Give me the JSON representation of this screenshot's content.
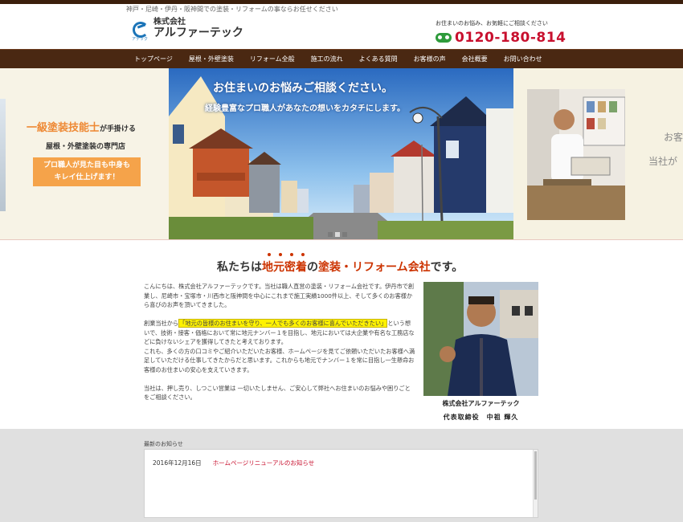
{
  "header": {
    "tagline": "神戸・尼崎・伊丹・阪神間での塗装・リフォームの事ならお任せください",
    "logo_line1": "株式会社",
    "logo_line2": "アルファーテック",
    "logo_sub": "アテック",
    "contact_lead": "お住まいのお悩み、お気軽にご相談ください",
    "phone": "0120-180-814"
  },
  "nav": {
    "items": [
      "トップページ",
      "屋根・外壁塗装",
      "リフォーム全般",
      "施工の流れ",
      "よくある質問",
      "お客様の声",
      "会社概要",
      "お問い合わせ"
    ]
  },
  "hero": {
    "left_accent": "一級塗装技能士",
    "left_title_rest": "が手掛ける",
    "left_sub": "屋根・外壁塗装の専門店",
    "left_box_line1": "プロ職人が見た目も中身も",
    "left_box_line2": "キレイ仕上げます！",
    "main_title": "お住まいのお悩みご相談ください。",
    "main_sub": "経験豊富なプロ職人があなたの想いをカタチにします。",
    "right_text1": "お客",
    "right_text2": "当社が",
    "slide_count": 3,
    "active_slide": 2
  },
  "section": {
    "title_pre": "私たちは",
    "title_hl1": "地元密着",
    "title_mid": "の",
    "title_hl2": "塗装・リフォーム会社",
    "title_post": "です。",
    "p1": "こんにちは、株式会社アルファーテックです。当社は職人直営の塗装・リフォーム会社です。伊丹市で創業し、尼崎市・宝塚市・川西市と阪神間を中心にこれまで施工実績1000件以上、そして多くのお客様から喜びのお声を頂いてきました。",
    "p2_pre": "創業当社から",
    "p2_mark": "「地元の皆様のお住まいを守り、一人でも多くのお客様に喜んでいただきたい」",
    "p2_post": "という想いで、技術・接客・価格において常に地元ナンバー１を目指し、地元においては大企業や有名な工務店などに負けないシェアを獲得してきたと考えております。",
    "p3": "これも、多くの方の口コミやご紹介いただいたお客様、ホームページを見てご依頼いただいたお客様へ満足していただける仕事してきたからだと思います。これからも地元でナンバー１を常に目指し一生懸命お客様のお住まいの安心を支えていきます。",
    "p4": "当社は、押し売り、しつこい営業は 一切いたしません、ご安心して弊社へお住まいのお悩みや困りごとをご相談ください。",
    "owner_company": "株式会社アルファーテック",
    "owner_title": "代表取締役　中祖 輝久"
  },
  "news": {
    "label": "最新のお知らせ",
    "items": [
      {
        "date": "2016年12月16日",
        "title": "ホームページリニューアルのお知らせ"
      }
    ]
  },
  "colors": {
    "nav_bg": "#4a2812",
    "accent_orange": "#ee8833",
    "phone_red": "#c8102e",
    "highlight_red": "#cc3300"
  }
}
